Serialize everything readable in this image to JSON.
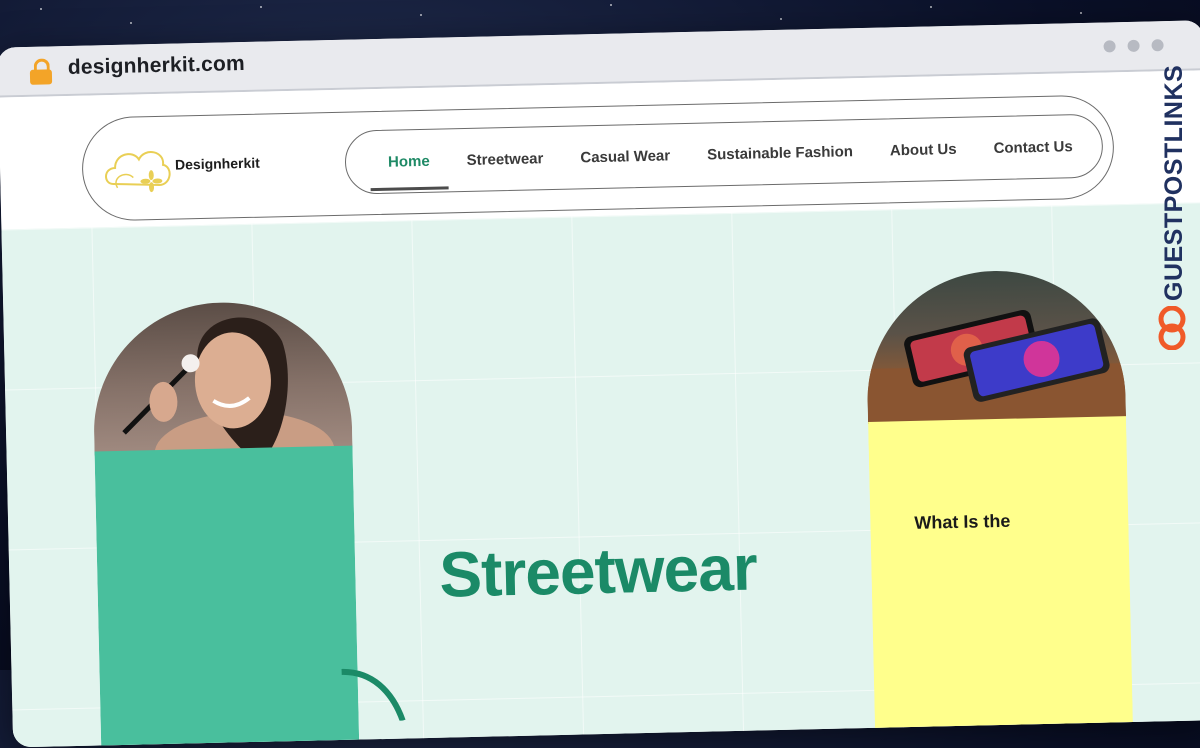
{
  "browser": {
    "url": "designherkit.com"
  },
  "site": {
    "logo_text": "Designherkit",
    "nav": [
      {
        "label": "Home",
        "active": true
      },
      {
        "label": "Streetwear",
        "active": false
      },
      {
        "label": "Casual Wear",
        "active": false
      },
      {
        "label": "Sustainable Fashion",
        "active": false
      },
      {
        "label": "About Us",
        "active": false
      },
      {
        "label": "Contact Us",
        "active": false
      }
    ]
  },
  "hero": {
    "title": "Streetwear",
    "right_card_title": "What Is the"
  },
  "watermark": {
    "text": "GUESTPOSTLINKS"
  },
  "colors": {
    "accent_green": "#1b8a67",
    "panel_green": "#49bf9d",
    "panel_yellow": "#ffff8c",
    "hero_bg": "#e2f4ee",
    "lock": "#f3a428",
    "watermark_orange": "#f05a28"
  },
  "icons": [
    "lock-icon",
    "window-dots-icon",
    "logo-cloud-flower-icon",
    "link-chain-icon"
  ]
}
